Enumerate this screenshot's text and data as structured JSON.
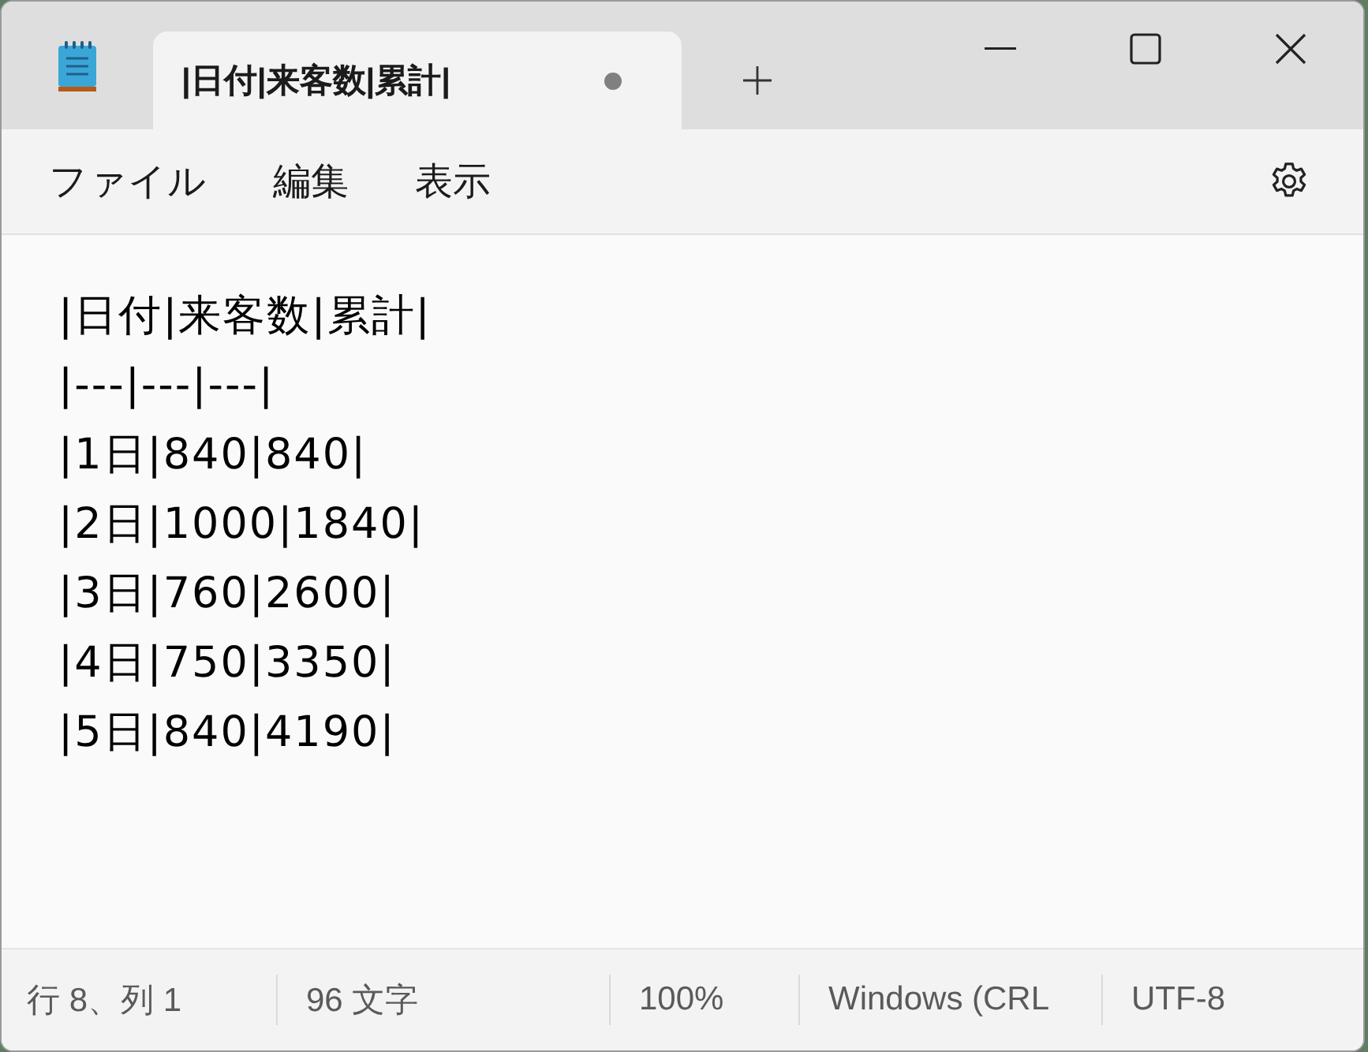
{
  "tabs": [
    {
      "title": "|日付|来客数|累計|",
      "selected": true,
      "modified": true
    }
  ],
  "menu": [
    "ファイル",
    "編集",
    "表示"
  ],
  "editor": {
    "lines": [
      "|日付|来客数|累計|",
      "|---|---|---|",
      "|1日|840|840|",
      "|2日|1000|1840|",
      "|3日|760|2600|",
      "|4日|750|3350|",
      "|5日|840|4190|"
    ]
  },
  "status_bar": [
    "行 8、列 1",
    "96 文字",
    "100%",
    "Windows (CRL",
    "UTF-8"
  ]
}
